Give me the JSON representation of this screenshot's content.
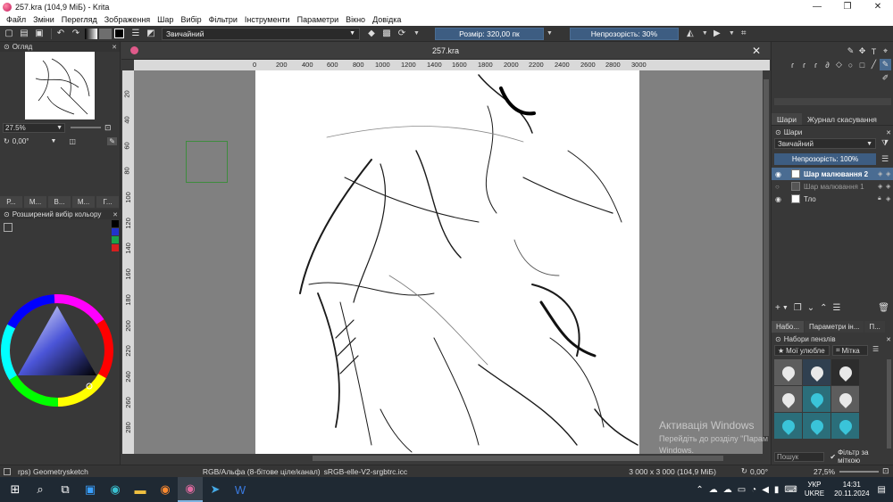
{
  "window": {
    "title": "257.kra (104,9 МіБ) - Krita",
    "min": "—",
    "max": "❐",
    "close": "✕"
  },
  "menu": [
    "Файл",
    "Зміни",
    "Перегляд",
    "Зображення",
    "Шар",
    "Вибір",
    "Фільтри",
    "Інструменти",
    "Параметри",
    "Вікно",
    "Довідка"
  ],
  "toolbar": {
    "blend_mode": "Звичайний",
    "size_label": "Розмір: 320,00 пк",
    "opacity_label": "Непрозорість: 30%"
  },
  "left_dock": {
    "overview_title": "Огляд",
    "zoom_value": "27.5%",
    "rotation_value": "0,00°",
    "tabs": [
      "Р...",
      "М...",
      "В...",
      "М...",
      "Г..."
    ],
    "color_selector_title": "Розширений вибір кольору"
  },
  "document": {
    "tab_name": "257.kra",
    "close": "✕"
  },
  "rulers": {
    "h_ticks": [
      "0",
      "200",
      "400",
      "600",
      "800",
      "1000",
      "1200",
      "1400",
      "1600",
      "1800",
      "2000",
      "2200",
      "2400",
      "2600",
      "2800",
      "3000"
    ],
    "v_ticks": [
      "20",
      "40",
      "60",
      "80",
      "100",
      "120",
      "140",
      "160",
      "180",
      "200",
      "220",
      "240",
      "260",
      "280"
    ]
  },
  "right_dock": {
    "tabs": [
      "Шари",
      "Журнал скасування"
    ],
    "layers_title": "Шари",
    "layer_blend": "Звичайний",
    "layer_opacity": "Непрозорість:  100%",
    "layers": [
      {
        "name": "Шар малювання 2",
        "active": true
      },
      {
        "name": "Шар малювання 1",
        "active": false
      },
      {
        "name": "Тло",
        "active": false
      }
    ],
    "brush_tabs": [
      "Набо...",
      "Параметри ін...",
      "П..."
    ],
    "brush_title": "Набори пензлів",
    "brush_filter": "Мої улюбле",
    "brush_tag": "Мітка",
    "search_placeholder": "Пошук",
    "filter_by_tag": "Фільтр за міткою"
  },
  "statusbar": {
    "brush": "rps) Geometrysketch",
    "colorspace": "RGB/Альфа (8-бітове ціле/канал)",
    "profile": "sRGB-elle-V2-srgbtrc.icc",
    "doc_size": "3 000 x 3 000 (104,9 МіБ)",
    "rotation": "0,00°",
    "zoom": "27,5%"
  },
  "watermark": {
    "line1": "Активація Windows",
    "line2": "Перейдіть до розділу \"Парам",
    "line3": "Windows."
  },
  "taskbar": {
    "lang_top": "УКР",
    "lang_bottom": "UKRE",
    "time": "14:31",
    "date": "20.11.2024"
  },
  "colors": {
    "accent": "#4a6c92",
    "panel": "#383838",
    "canvas_bg": "#808080"
  }
}
